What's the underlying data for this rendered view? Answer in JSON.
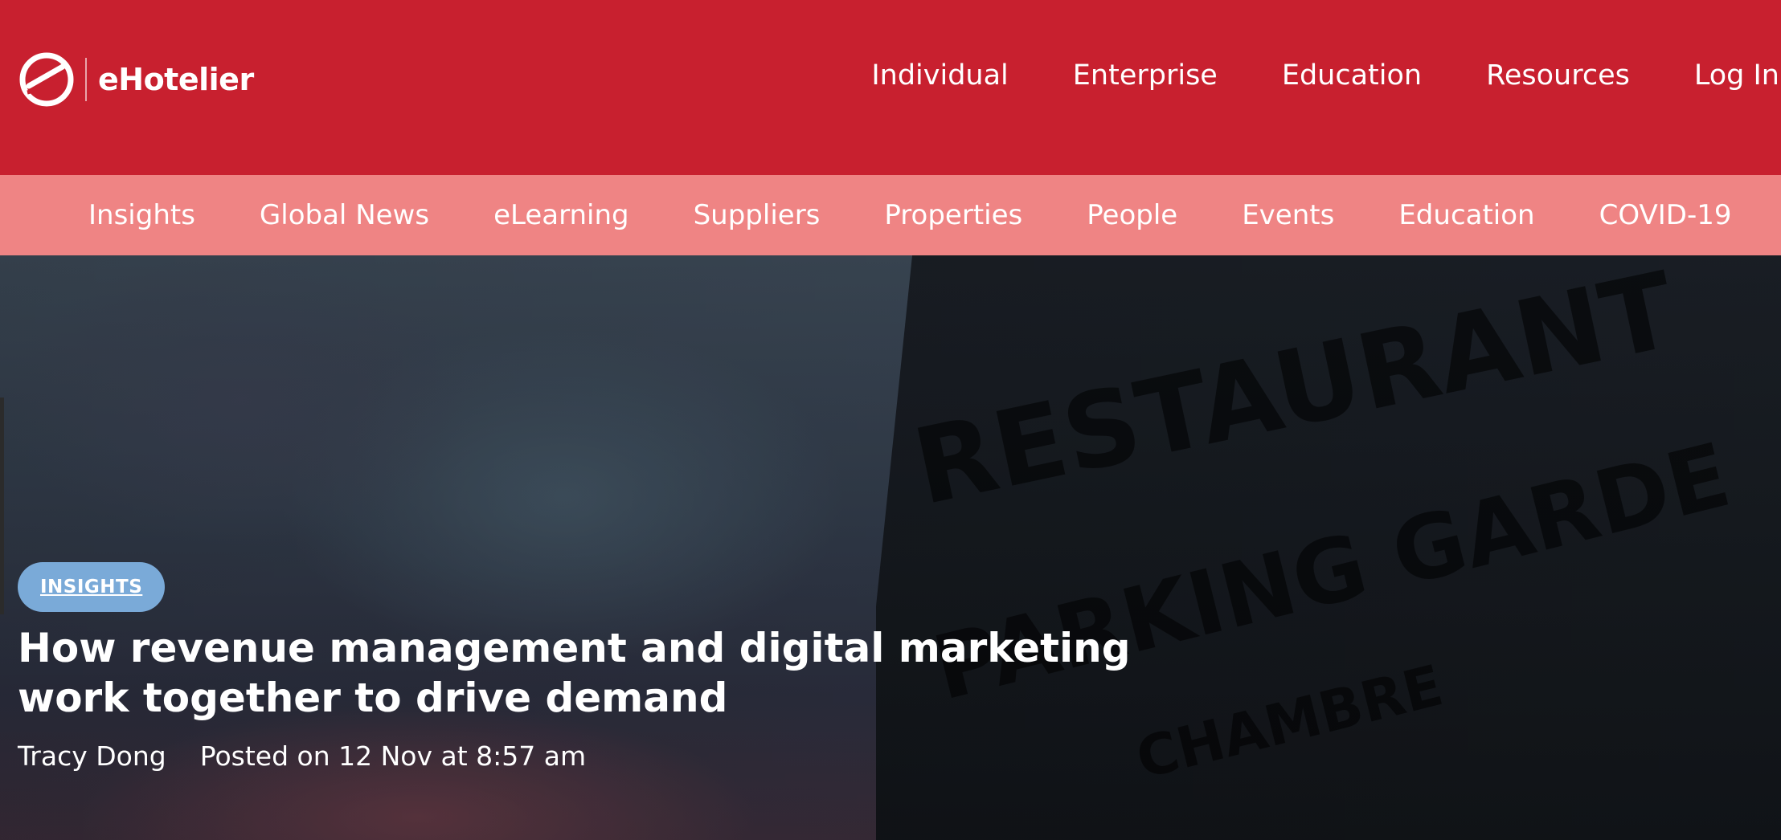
{
  "brand": {
    "name": "eHotelier"
  },
  "top_nav": [
    "Individual",
    "Enterprise",
    "Education",
    "Resources",
    "Log In"
  ],
  "sub_nav": [
    "Insights",
    "Global News",
    "eLearning",
    "Suppliers",
    "Properties",
    "People",
    "Events",
    "Education",
    "COVID-19"
  ],
  "article": {
    "category": "INSIGHTS",
    "title": "How revenue management and digital marketing work together to drive demand",
    "author": "Tracy Dong",
    "posted": "Posted on 12 Nov at 8:57 am"
  },
  "colors": {
    "header": "#c8202f",
    "subnav": "#ef8484",
    "badge": "#7aaad8"
  }
}
